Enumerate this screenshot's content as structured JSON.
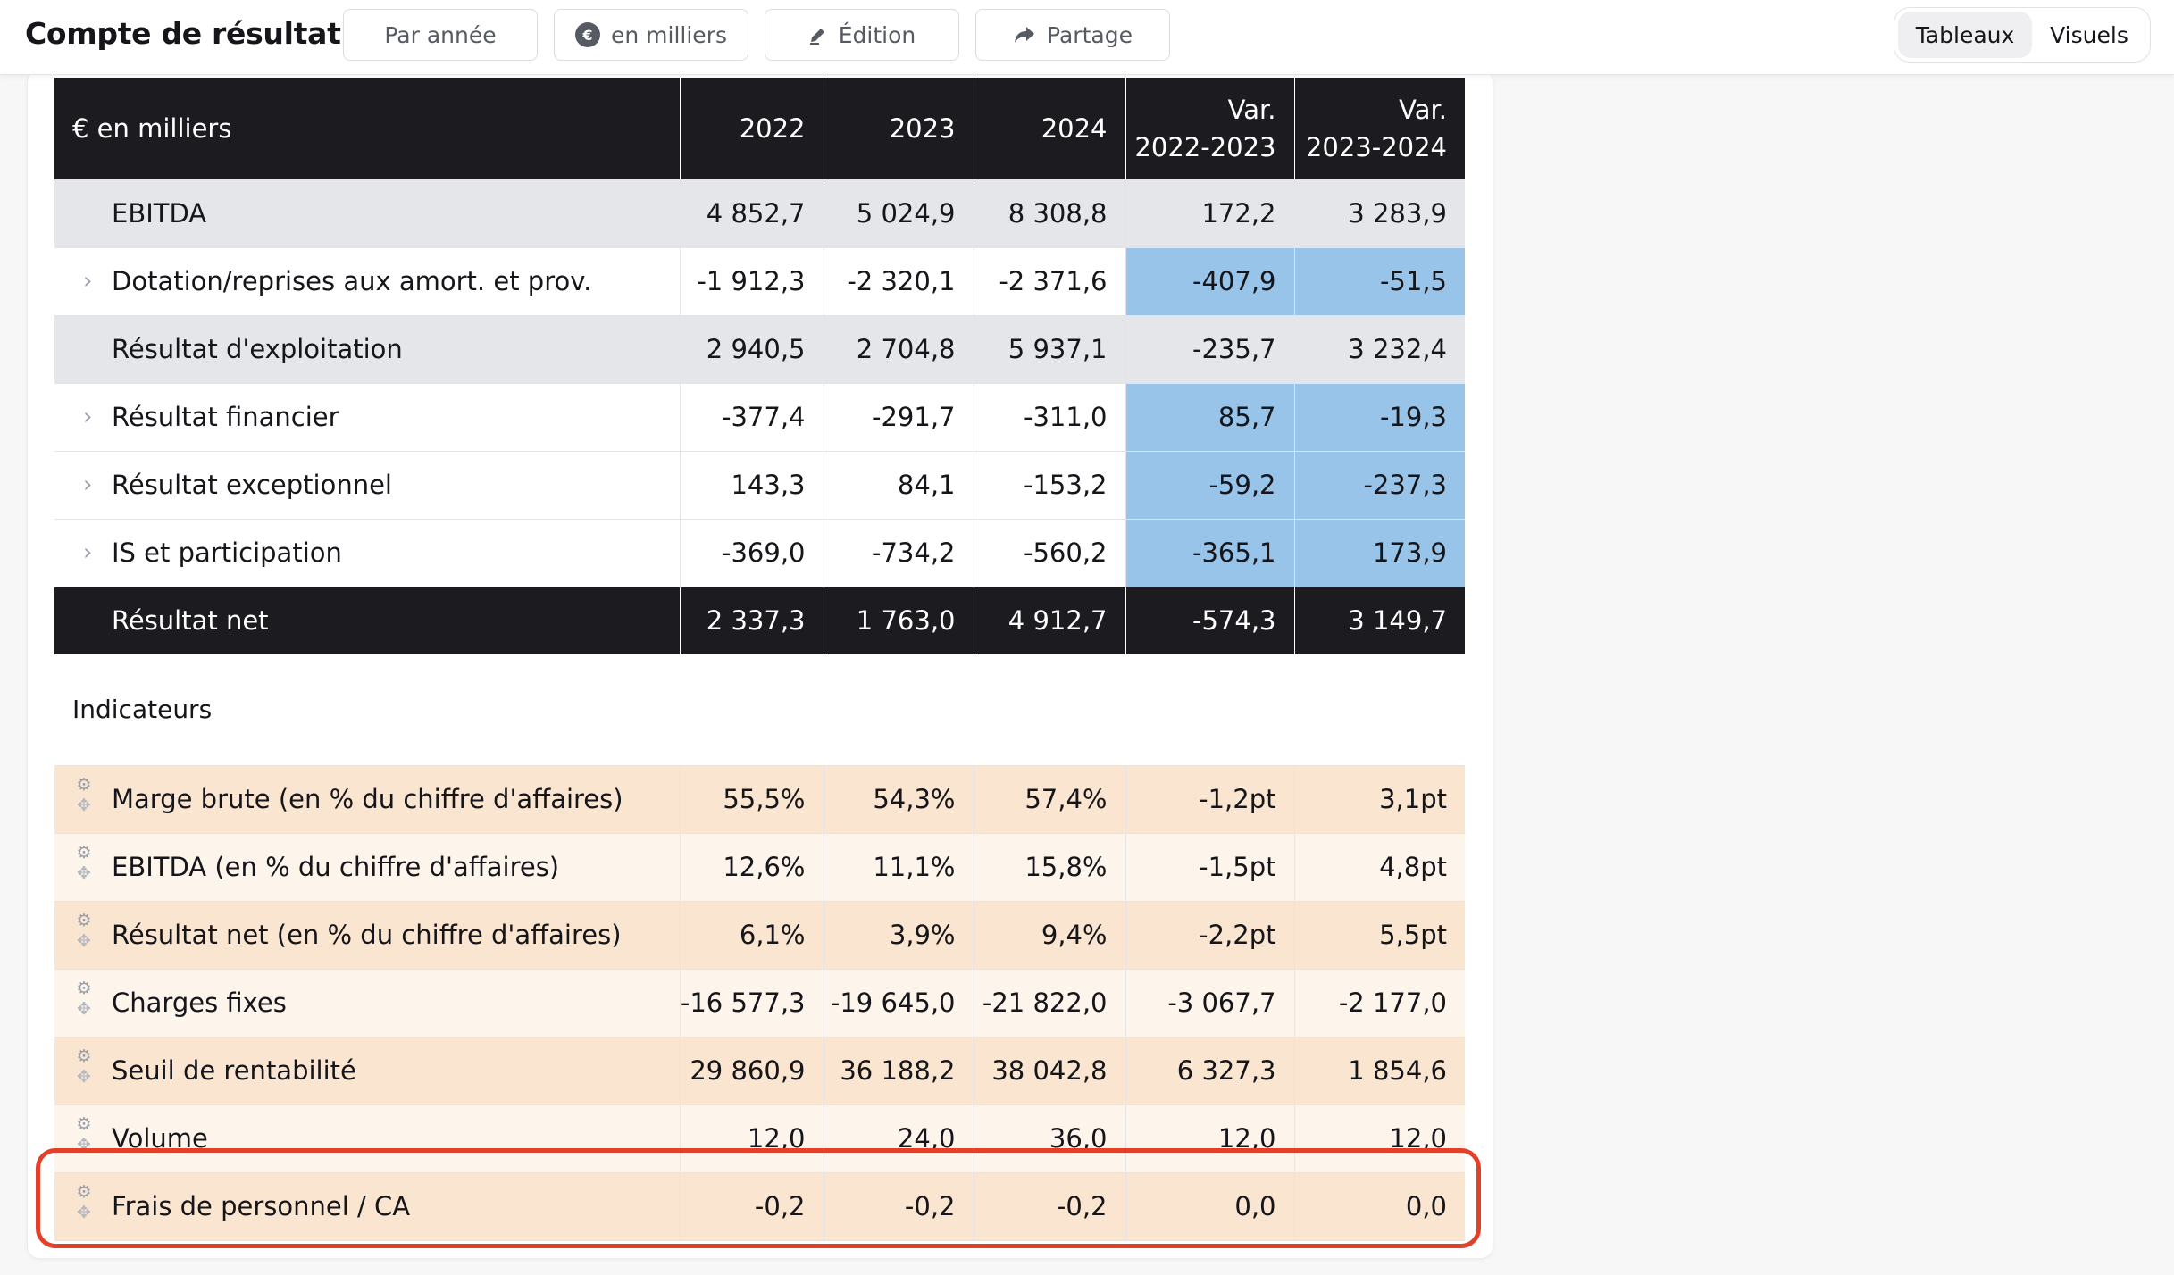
{
  "header": {
    "title": "Compte de résultat",
    "buttons": [
      {
        "label": "Par année",
        "icon": "none"
      },
      {
        "label": "en milliers",
        "icon": "euro-circle-icon"
      },
      {
        "label": "Édition",
        "icon": "pencil-icon"
      },
      {
        "label": "Partage",
        "icon": "share-arrow-icon"
      }
    ],
    "view_toggle": {
      "options": [
        "Tableaux",
        "Visuels"
      ],
      "selected": "Tableaux"
    }
  },
  "table": {
    "unit_label": "€ en milliers",
    "columns": [
      "2022",
      "2023",
      "2024",
      "Var.\n2022-2023",
      "Var.\n2023-2024"
    ],
    "col_line1": [
      "2022",
      "2023",
      "2024",
      "Var.",
      "Var."
    ],
    "col_line2": [
      "",
      "",
      "",
      "2022-2023",
      "2023-2024"
    ],
    "rows": [
      {
        "label": "EBITDA",
        "values": [
          "4 852,7",
          "5 024,9",
          "8 308,8",
          "172,2",
          "3 283,9"
        ],
        "kind": "subtotal"
      },
      {
        "label": "Dotation/reprises aux amort. et prov.",
        "values": [
          "-1 912,3",
          "-2 320,1",
          "-2 371,6",
          "-407,9",
          "-51,5"
        ],
        "kind": "expandable"
      },
      {
        "label": "Résultat d'exploitation",
        "values": [
          "2 940,5",
          "2 704,8",
          "5 937,1",
          "-235,7",
          "3 232,4"
        ],
        "kind": "subtotal"
      },
      {
        "label": "Résultat financier",
        "values": [
          "-377,4",
          "-291,7",
          "-311,0",
          "85,7",
          "-19,3"
        ],
        "kind": "expandable"
      },
      {
        "label": "Résultat exceptionnel",
        "values": [
          "143,3",
          "84,1",
          "-153,2",
          "-59,2",
          "-237,3"
        ],
        "kind": "expandable"
      },
      {
        "label": "IS et participation",
        "values": [
          "-369,0",
          "-734,2",
          "-560,2",
          "-365,1",
          "173,9"
        ],
        "kind": "expandable"
      },
      {
        "label": "Résultat net",
        "values": [
          "2 337,3",
          "1 763,0",
          "4 912,7",
          "-574,3",
          "3 149,7"
        ],
        "kind": "total"
      }
    ],
    "indicators_title": "Indicateurs",
    "indicators": [
      {
        "label": "Marge brute (en % du chiffre d'affaires)",
        "values": [
          "55,5%",
          "54,3%",
          "57,4%",
          "-1,2pt",
          "3,1pt"
        ]
      },
      {
        "label": "EBITDA (en % du chiffre d'affaires)",
        "values": [
          "12,6%",
          "11,1%",
          "15,8%",
          "-1,5pt",
          "4,8pt"
        ]
      },
      {
        "label": "Résultat net (en % du chiffre d'affaires)",
        "values": [
          "6,1%",
          "3,9%",
          "9,4%",
          "-2,2pt",
          "5,5pt"
        ]
      },
      {
        "label": "Charges fixes",
        "values": [
          "-16 577,3",
          "-19 645,0",
          "-21 822,0",
          "-3 067,7",
          "-2 177,0"
        ]
      },
      {
        "label": "Seuil de rentabilité",
        "values": [
          "29 860,9",
          "36 188,2",
          "38 042,8",
          "6 327,3",
          "1 854,6"
        ]
      },
      {
        "label": "Volume",
        "values": [
          "12,0",
          "24,0",
          "36,0",
          "12,0",
          "12,0"
        ]
      },
      {
        "label": "Frais de personnel / CA",
        "values": [
          "-0,2",
          "-0,2",
          "-0,2",
          "0,0",
          "0,0"
        ],
        "highlighted": true
      }
    ]
  },
  "colors": {
    "header_dark": "#1c1c20",
    "subtotal_row": "#e4e6ea",
    "variance_highlight": "#99c4ea",
    "indicator_row_a": "#fae5d0",
    "indicator_row_b": "#fdf4ec",
    "callout_border": "#e3402a"
  }
}
